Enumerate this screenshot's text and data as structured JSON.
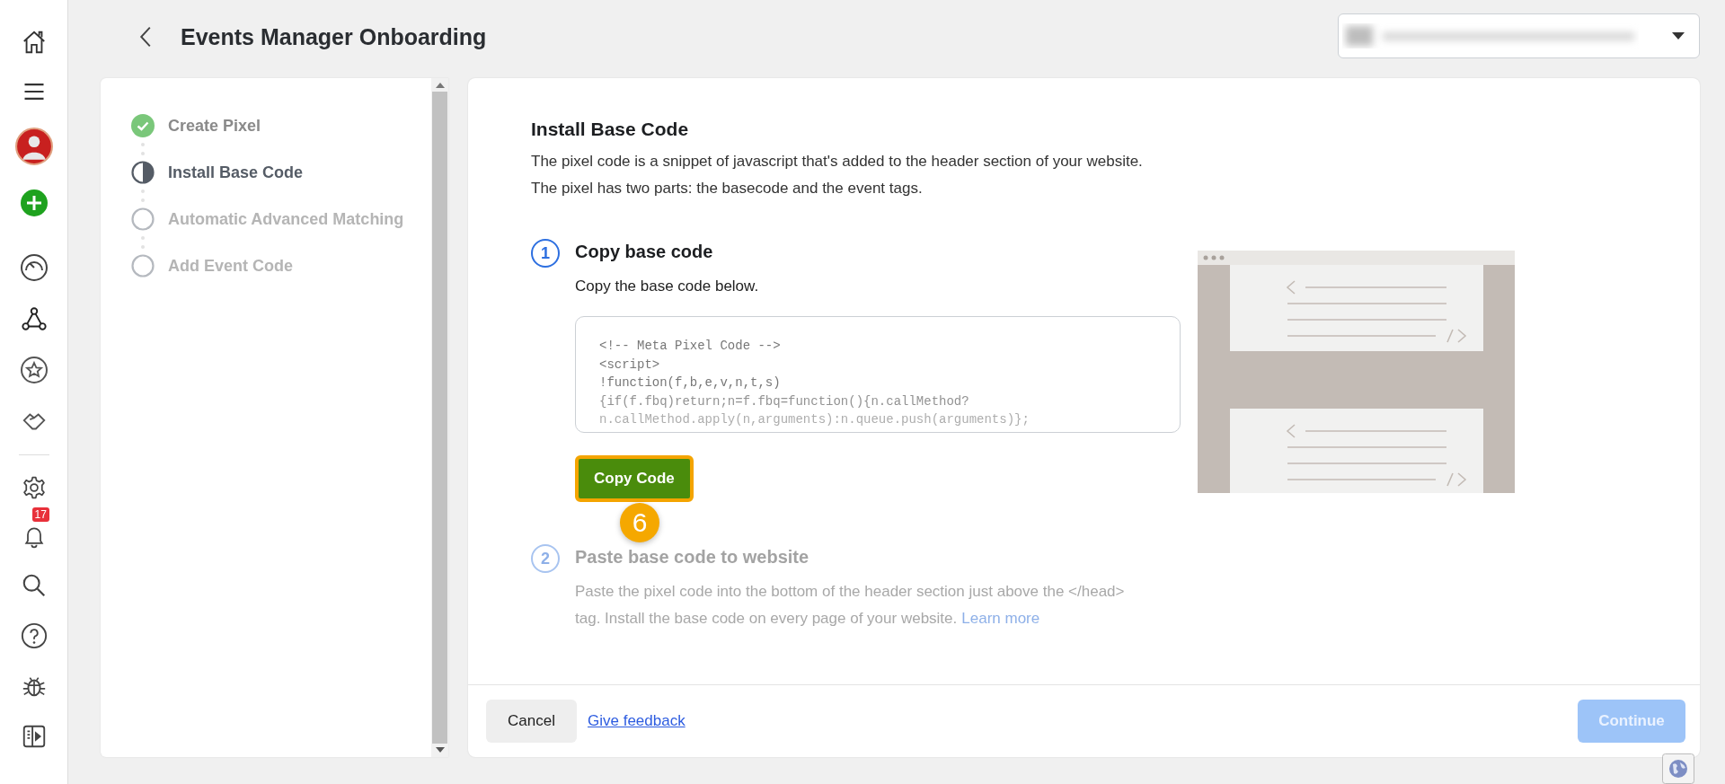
{
  "nav": {
    "notification_badge": "17"
  },
  "header": {
    "title": "Events Manager Onboarding"
  },
  "steps": [
    {
      "label": "Create Pixel",
      "kind": "done"
    },
    {
      "label": "Install Base Code",
      "kind": "current"
    },
    {
      "label": "Automatic Advanced Matching",
      "kind": "todo"
    },
    {
      "label": "Add Event Code",
      "kind": "todo"
    }
  ],
  "content": {
    "title": "Install Base Code",
    "description": [
      "The pixel code is a snippet of javascript that's added to the header section of your website.",
      "The pixel has two parts: the basecode and the event tags."
    ],
    "sections": [
      {
        "number": "1",
        "title": "Copy base code",
        "active": true,
        "text": "Copy the base code below.",
        "code_lines": [
          "<!-- Meta Pixel Code -->",
          "<script>",
          "!function(f,b,e,v,n,t,s)",
          "{if(f.fbq)return;n=f.fbq=function(){n.callMethod?",
          "n.callMethod.apply(n,arguments):n.queue.push(arguments)};"
        ],
        "button": "Copy Code",
        "callout": "6"
      },
      {
        "number": "2",
        "title": "Paste base code to website",
        "active": false,
        "text": "Paste the pixel code into the bottom of the header section just above the </head> tag. Install the base code on every page of your website.",
        "link": "Learn more"
      }
    ]
  },
  "footer": {
    "cancel": "Cancel",
    "feedback": "Give feedback",
    "continue": {
      "label": "Continue",
      "disabled": true
    }
  }
}
